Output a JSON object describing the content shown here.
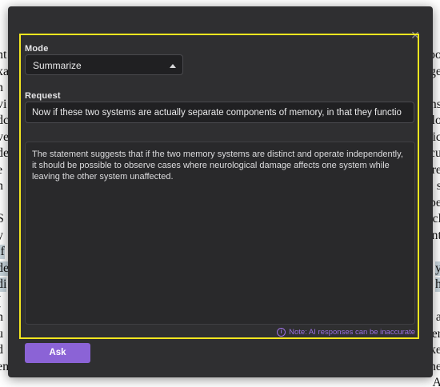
{
  "background_document": {
    "left_fragments": [
      "nt",
      "xa",
      "n",
      "vi",
      "dc",
      "ve",
      "de",
      "e",
      "n",
      ",",
      "S",
      "y",
      "if",
      "de",
      "di",
      "(",
      "n",
      "u",
      "d",
      "en"
    ],
    "right_fragments": [
      "oo",
      "ge",
      "",
      "ns",
      "lo",
      "ic",
      "cu",
      "re",
      "s",
      "pe",
      "cl",
      "nt",
      "",
      "y",
      "h",
      "",
      "a",
      "er",
      "ke",
      "he",
      "A"
    ],
    "highlighted_rows": [
      12,
      13,
      14
    ]
  },
  "dialog": {
    "close_icon": "×",
    "mode": {
      "label": "Mode",
      "selected": "Summarize"
    },
    "request": {
      "label": "Request",
      "value": "Now if these two systems are actually separate components of memory, in that they functio"
    },
    "response": {
      "text": "The statement suggests that if the two memory systems are distinct and operate independently, it should be possible to observe cases where neurological damage affects one system while leaving the other system unaffected."
    },
    "note": {
      "icon": "i",
      "text": "Note: AI responses can be inaccurate"
    },
    "ask_label": "Ask"
  },
  "colors": {
    "dialog_bg": "#2f2f31",
    "highlight_frame": "#f3e61f",
    "accent": "#8b63d6",
    "note": "#9b6fe0"
  }
}
